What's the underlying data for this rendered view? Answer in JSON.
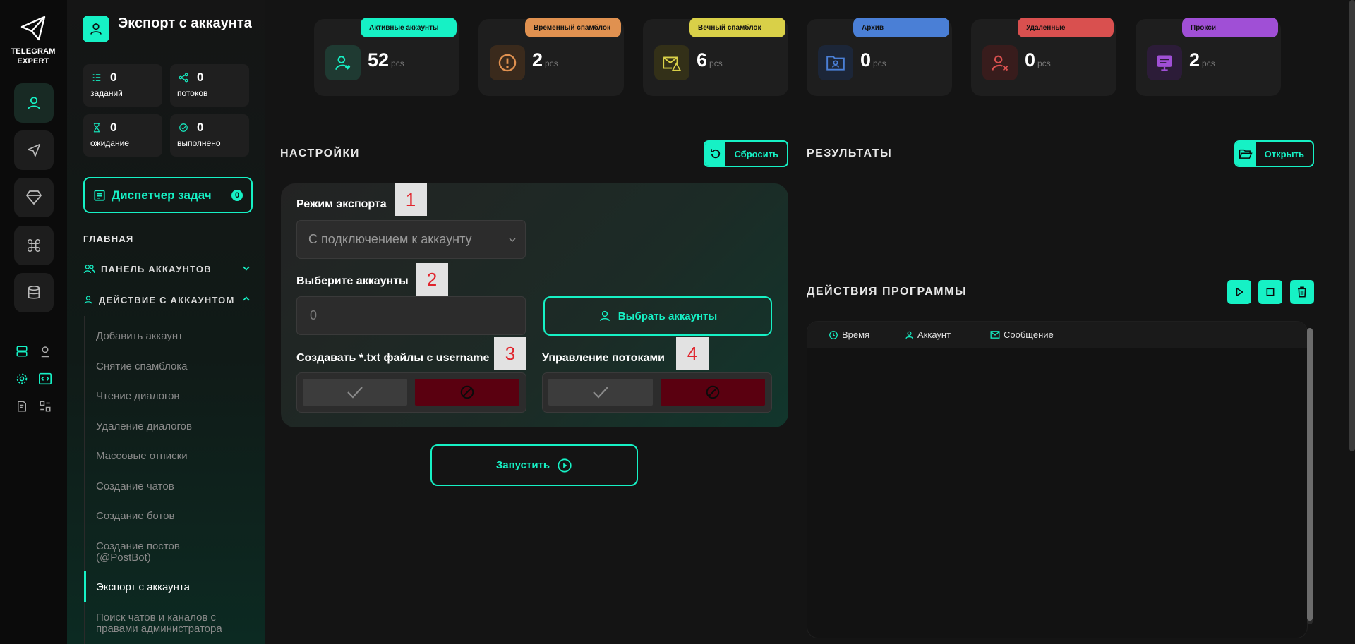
{
  "app": {
    "logo_line1": "TELEGRAM",
    "logo_line2": "EXPERT"
  },
  "colors": {
    "accent": "#16f1c5",
    "bg": "#141414",
    "danger": "#5a0010"
  },
  "sidebar": {
    "title": "Экспорт с аккаунта",
    "stats": [
      {
        "value": "0",
        "label": "заданий",
        "icon": "tasks-icon"
      },
      {
        "value": "0",
        "label": "потоков",
        "icon": "share-nodes-icon"
      },
      {
        "value": "0",
        "label": "ожидание",
        "icon": "hourglass-icon"
      },
      {
        "value": "0",
        "label": "выполнено",
        "icon": "check-circle-icon"
      }
    ],
    "dispatcher": {
      "label": "Диспетчер задач",
      "badge": "0"
    },
    "section_main": "ГЛАВНАЯ",
    "group_accounts": "ПАНЕЛЬ АККАУНТОВ",
    "group_actions": "ДЕЙСТВИЕ С АККАУНТОМ",
    "items": [
      "Добавить аккаунт",
      "Снятие спамблока",
      "Чтение диалогов",
      "Удаление диалогов",
      "Массовые отписки",
      "Создание чатов",
      "Создание ботов",
      "Создание постов (@PostBot)",
      "Экспорт с аккаунта",
      "Поиск чатов и каналов с правами администратора"
    ]
  },
  "top_cards": [
    {
      "label": "Активные аккаунты",
      "value": "52",
      "unit": "pcs",
      "color": "#16f1c5"
    },
    {
      "label": "Временный спамблок",
      "value": "2",
      "unit": "pcs",
      "color": "#e09150"
    },
    {
      "label": "Вечный спамблок",
      "value": "6",
      "unit": "pcs",
      "color": "#d9d048"
    },
    {
      "label": "Архив",
      "value": "0",
      "unit": "pcs",
      "color": "#4a7fd6"
    },
    {
      "label": "Удаленные",
      "value": "0",
      "unit": "pcs",
      "color": "#d9504f"
    },
    {
      "label": "Прокси",
      "value": "2",
      "unit": "pcs",
      "color": "#a04fd6"
    }
  ],
  "settings": {
    "title": "НАСТРОЙКИ",
    "reset_label": "Сбросить",
    "mode_label": "Режим экспорта",
    "mode_value": "С подключением к аккаунту",
    "accounts_label": "Выберите аккаунты",
    "accounts_value": "0",
    "choose_label": "Выбрать аккаунты",
    "txt_label": "Создавать *.txt файлы с username",
    "threads_label": "Управление потоками",
    "tags": [
      "1",
      "2",
      "3",
      "4"
    ],
    "run_label": "Запустить"
  },
  "results": {
    "title": "РЕЗУЛЬТАТЫ",
    "open_label": "Открыть"
  },
  "actions": {
    "title": "ДЕЙСТВИЯ ПРОГРАММЫ",
    "columns": [
      "Время",
      "Аккаунт",
      "Сообщение"
    ]
  }
}
